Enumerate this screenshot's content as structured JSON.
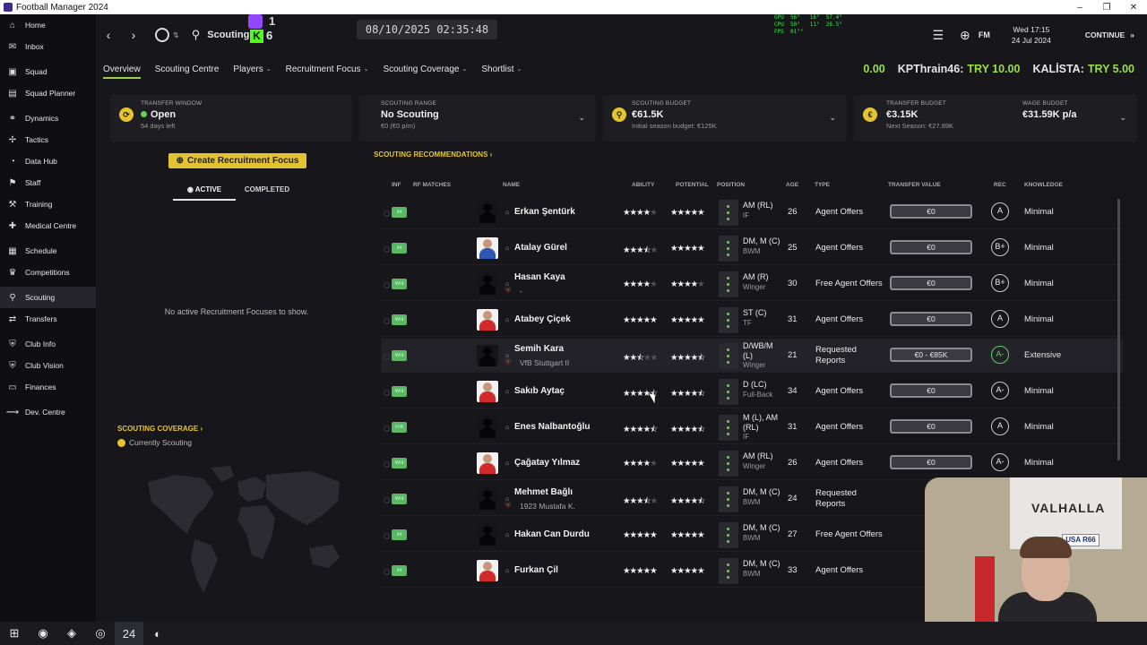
{
  "window": {
    "title": "Football Manager 2024",
    "controls": [
      "–",
      "❐",
      "✕"
    ]
  },
  "sidebar": {
    "items": [
      {
        "label": "Home",
        "icon": "home-icon",
        "glyph": "⌂"
      },
      {
        "label": "Inbox",
        "icon": "inbox-icon",
        "glyph": "✉"
      },
      {
        "label": "Squad",
        "icon": "squad-icon",
        "glyph": "▣"
      },
      {
        "label": "Squad Planner",
        "icon": "planner-icon",
        "glyph": "▤"
      },
      {
        "label": "Dynamics",
        "icon": "dynamics-icon",
        "glyph": "⚭"
      },
      {
        "label": "Tactics",
        "icon": "tactics-icon",
        "glyph": "✢"
      },
      {
        "label": "Data Hub",
        "icon": "data-hub-icon",
        "glyph": "◔"
      },
      {
        "label": "Staff",
        "icon": "staff-icon",
        "glyph": "⚑"
      },
      {
        "label": "Training",
        "icon": "training-icon",
        "glyph": "⚒"
      },
      {
        "label": "Medical Centre",
        "icon": "medical-icon",
        "glyph": "✚"
      },
      {
        "label": "Schedule",
        "icon": "schedule-icon",
        "glyph": "▦"
      },
      {
        "label": "Competitions",
        "icon": "trophy-icon",
        "glyph": "♛"
      },
      {
        "label": "Scouting",
        "icon": "scouting-icon",
        "glyph": "⚲"
      },
      {
        "label": "Transfers",
        "icon": "transfers-icon",
        "glyph": "⇄"
      },
      {
        "label": "Club Info",
        "icon": "club-info-icon",
        "glyph": "⛨"
      },
      {
        "label": "Club Vision",
        "icon": "club-vision-icon",
        "glyph": "⛨"
      },
      {
        "label": "Finances",
        "icon": "finances-icon",
        "glyph": "▭"
      },
      {
        "label": "Dev. Centre",
        "icon": "dev-centre-icon",
        "glyph": "⟿"
      }
    ]
  },
  "topbar": {
    "back": "‹",
    "forward": "›",
    "search_title": "Scouting",
    "clock": "08/10/2025 02:35:48",
    "twitch_count": "1",
    "kick_letter": "K",
    "kick_count": "6",
    "perf": "GPU  56°   16°  57.4°\nCPU  50°   11°  28.5°\nFPS  01°°",
    "fm_label": "FM",
    "date_line1": "Wed 17:15",
    "date_line2": "24 Jul 2024",
    "continue_label": "CONTINUE"
  },
  "subnav": {
    "tabs": [
      {
        "label": "Overview",
        "caret": ""
      },
      {
        "label": "Scouting Centre",
        "caret": ""
      },
      {
        "label": "Players",
        "caret": "⌄"
      },
      {
        "label": "Recruitment Focus",
        "caret": "⌄"
      },
      {
        "label": "Scouting Coverage",
        "caret": "⌄"
      },
      {
        "label": "Shortlist",
        "caret": "⌄"
      }
    ]
  },
  "balances": {
    "zero": "0.00",
    "kp_name": "KPThrain46:",
    "kp_value": "TRY 10.00",
    "kalista_name": "KALİSTA:",
    "kalista_value": "TRY 5.00"
  },
  "summary": {
    "transfer_window": {
      "label": "TRANSFER WINDOW",
      "value": "Open",
      "sub": "54 days left"
    },
    "scouting_range": {
      "label": "SCOUTING RANGE",
      "value": "No Scouting",
      "sub": "€0 (€0 p/m)"
    },
    "scouting_budget": {
      "label": "SCOUTING BUDGET",
      "value": "€61.5K",
      "sub": "Initial season budget: €125K"
    },
    "transfer_budget": {
      "label": "TRANSFER BUDGET",
      "value": "€3.15K",
      "sub": "Next Season: €27.89K"
    },
    "wage_budget": {
      "label": "WAGE BUDGET",
      "value": "€31.59K p/a"
    }
  },
  "recruitment": {
    "create_button": "Create Recruitment Focus",
    "tab_active": "ACTIVE",
    "tab_completed": "COMPLETED",
    "empty_text": "No active Recruitment Focuses to show."
  },
  "coverage": {
    "title": "SCOUTING COVERAGE ›",
    "legend": "Currently Scouting"
  },
  "recommendations": {
    "title": "SCOUTING RECOMMENDATIONS ›",
    "columns": {
      "inf": "INF",
      "rf": "RF MATCHES",
      "name": "NAME",
      "ability": "ABILITY",
      "potential": "POTENTIAL",
      "position": "POSITION",
      "age": "AGE",
      "type": "TYPE",
      "tv": "TRANSFER VALUE",
      "rec": "REC",
      "knowledge": "KNOWLEDGE"
    },
    "rows": [
      {
        "inf": "Int",
        "name": "Erkan Şentürk",
        "club": "",
        "ability": 4,
        "potential": 5,
        "pos1": "AM (RL)",
        "pos2": "",
        "role": "IF",
        "age": "26",
        "type1": "Agent Offers",
        "type2": "",
        "tv": "€0",
        "rec": "A",
        "rec_green": false,
        "knowledge": "Minimal",
        "photo": "",
        "shirt": "red"
      },
      {
        "inf": "Int",
        "name": "Atalay Gürel",
        "club": "",
        "ability": 3.5,
        "potential": 5,
        "pos1": "DM, M (C)",
        "pos2": "",
        "role": "BWM",
        "age": "25",
        "type1": "Agent Offers",
        "type2": "",
        "tv": "€0",
        "rec": "B+",
        "rec_green": false,
        "knowledge": "Minimal",
        "photo": "photo",
        "shirt": "blue"
      },
      {
        "inf": "Wnt",
        "name": "Hasan Kaya",
        "club": "-",
        "ability": 4,
        "potential": 4,
        "pos1": "AM (R)",
        "pos2": "",
        "role": "Winger",
        "age": "30",
        "type1": "Free Agent Offers",
        "type2": "",
        "tv": "€0",
        "rec": "B+",
        "rec_green": false,
        "knowledge": "Minimal",
        "photo": "",
        "shirt": "red"
      },
      {
        "inf": "Wnt",
        "name": "Atabey Çiçek",
        "club": "",
        "ability": 5,
        "potential": 5,
        "pos1": "ST (C)",
        "pos2": "",
        "role": "TF",
        "age": "31",
        "type1": "Agent Offers",
        "type2": "",
        "tv": "€0",
        "rec": "A",
        "rec_green": false,
        "knowledge": "Minimal",
        "photo": "photo",
        "shirt": "red"
      },
      {
        "inf": "Wnt",
        "name": "Semih Kara",
        "club": "VfB Stuttgart II",
        "ability": 2.5,
        "potential": 4.5,
        "pos1": "D/WB/M",
        "pos2": "(L)",
        "role": "Winger",
        "age": "21",
        "type1": "Requested",
        "type2": "Reports",
        "tv": "€0 - €85K",
        "rec": "A-",
        "rec_green": true,
        "knowledge": "Extensive",
        "photo": "",
        "shirt": "red"
      },
      {
        "inf": "Wnt",
        "name": "Sakıb Aytaç",
        "club": "",
        "ability": 4.5,
        "potential": 4.5,
        "pos1": "D (LC)",
        "pos2": "",
        "role": "Full-Back",
        "age": "34",
        "type1": "Agent Offers",
        "type2": "",
        "tv": "€0",
        "rec": "A-",
        "rec_green": false,
        "knowledge": "Minimal",
        "photo": "photo",
        "shirt": "red"
      },
      {
        "inf": "FrA",
        "name": "Enes Nalbantoğlu",
        "club": "",
        "ability": 4.5,
        "potential": 4.5,
        "pos1": "M (L), AM",
        "pos2": "(RL)",
        "role": "IF",
        "age": "31",
        "type1": "Agent Offers",
        "type2": "",
        "tv": "€0",
        "rec": "A",
        "rec_green": false,
        "knowledge": "Minimal",
        "photo": "",
        "shirt": "red"
      },
      {
        "inf": "Wnt",
        "name": "Çağatay Yılmaz",
        "club": "",
        "ability": 4,
        "potential": 5,
        "pos1": "AM (RL)",
        "pos2": "",
        "role": "Winger",
        "age": "26",
        "type1": "Agent Offers",
        "type2": "",
        "tv": "€0",
        "rec": "A-",
        "rec_green": false,
        "knowledge": "Minimal",
        "photo": "photo",
        "shirt": "red"
      },
      {
        "inf": "Wnt",
        "name": "Mehmet Bağlı",
        "club": "1923 Mustafa K.",
        "ability": 3.5,
        "potential": 4.5,
        "pos1": "DM, M (C)",
        "pos2": "",
        "role": "BWM",
        "age": "24",
        "type1": "Requested",
        "type2": "Reports",
        "tv": "",
        "rec": "",
        "rec_green": false,
        "knowledge": "",
        "photo": "",
        "shirt": "red"
      },
      {
        "inf": "Int",
        "name": "Hakan Can Durdu",
        "club": "",
        "ability": 5,
        "potential": 5,
        "pos1": "DM, M (C)",
        "pos2": "",
        "role": "BWM",
        "age": "27",
        "type1": "Free Agent Offers",
        "type2": "",
        "tv": "",
        "rec": "",
        "rec_green": false,
        "knowledge": "",
        "photo": "",
        "shirt": "red"
      },
      {
        "inf": "Int",
        "name": "Furkan Çil",
        "club": "",
        "ability": 5,
        "potential": 5,
        "pos1": "DM, M (C)",
        "pos2": "",
        "role": "BWM",
        "age": "33",
        "type1": "Agent Offers",
        "type2": "",
        "tv": "",
        "rec": "",
        "rec_green": false,
        "knowledge": "",
        "photo": "photo",
        "shirt": "red"
      }
    ]
  },
  "webcam": {
    "banner": "VALHALLA",
    "plate": "USA R66"
  },
  "taskbar": {
    "icons": [
      {
        "name": "windows-start-icon",
        "glyph": "⊞"
      },
      {
        "name": "chrome-icon",
        "glyph": "◉"
      },
      {
        "name": "steam-icon",
        "glyph": "◈"
      },
      {
        "name": "discord-icon",
        "glyph": "◎"
      },
      {
        "name": "fm24-icon",
        "glyph": "24"
      },
      {
        "name": "obs-icon",
        "glyph": "◐"
      }
    ]
  }
}
